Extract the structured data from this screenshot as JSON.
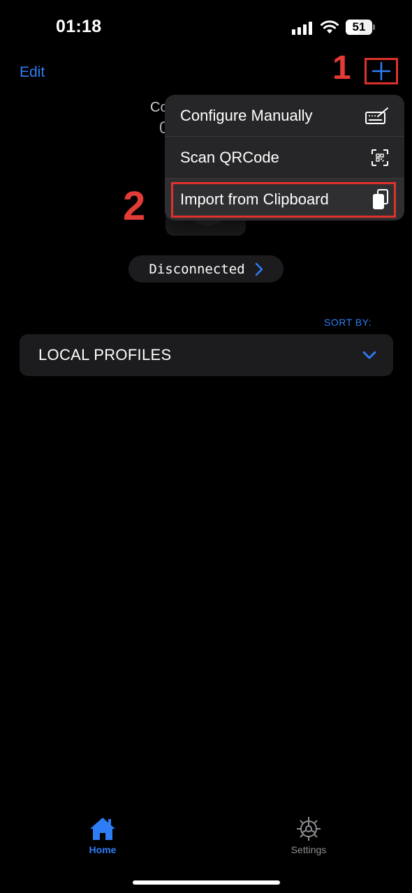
{
  "status_bar": {
    "time": "01:18",
    "battery": "51",
    "battery_level": 0.51
  },
  "nav": {
    "edit_label": "Edit",
    "annotation_1": "1",
    "annotation_2": "2"
  },
  "background": {
    "partial_text_1": "Co",
    "partial_text_2": "0"
  },
  "menu": {
    "items": [
      {
        "label": "Configure Manually",
        "icon": "keyboard-pencil-icon"
      },
      {
        "label": "Scan QRCode",
        "icon": "qrcode-scan-icon"
      },
      {
        "label": "Import from Clipboard",
        "icon": "clipboard-icon"
      }
    ]
  },
  "connection": {
    "status": "Disconnected"
  },
  "sort": {
    "label": "SORT BY:"
  },
  "profiles": {
    "selected": "LOCAL PROFILES"
  },
  "tabbar": {
    "home_label": "Home",
    "settings_label": "Settings"
  },
  "colors": {
    "accent": "#2f7df6",
    "annotation": "#e33b36",
    "background": "#000000",
    "card": "#1c1c1e",
    "menu": "#262628"
  }
}
